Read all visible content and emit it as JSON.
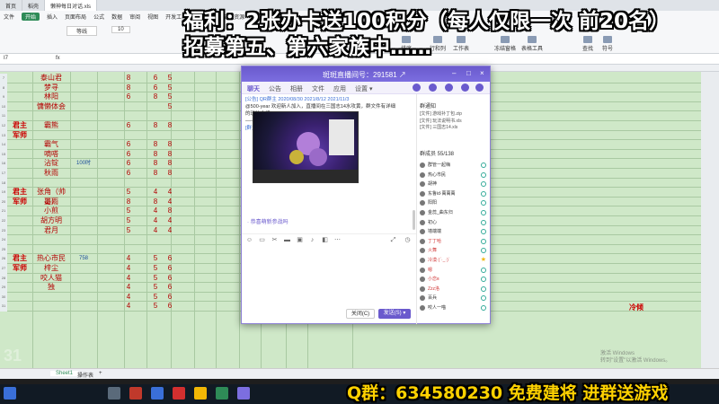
{
  "top_tabs": [
    "首页",
    "稻壳",
    "懒神每日对话.xls"
  ],
  "ribbon": {
    "menu": [
      "文件",
      "开始",
      "插入",
      "页面布局",
      "公式",
      "数据",
      "审阅",
      "视图",
      "开发工具",
      "会员专享",
      "稻壳资源"
    ],
    "font_name": "等线",
    "font_size": "10",
    "buttons": [
      "排序",
      "行和列",
      "工作表",
      "冻结窗格",
      "表格工具",
      "查找",
      "符号"
    ]
  },
  "formula_bar": {
    "cell_ref": "I7",
    "fx": "fx"
  },
  "rows": [
    {
      "n": "7",
      "role": "",
      "name": "泰山君",
      "note": "",
      "a": "8",
      "b": "6",
      "c": "5",
      "d": "",
      "e": "",
      "f": ""
    },
    {
      "n": "8",
      "role": "",
      "name": "梦寻",
      "note": "",
      "a": "8",
      "b": "6",
      "c": "5",
      "d": "",
      "e": "",
      "f": ""
    },
    {
      "n": "9",
      "role": "",
      "name": "林阳",
      "note": "",
      "a": "6",
      "b": "8",
      "c": "5",
      "d": "",
      "e": "",
      "f": ""
    },
    {
      "n": "10",
      "role": "",
      "name": "慵懒体会",
      "note": "",
      "a": "",
      "b": "",
      "c": "5",
      "d": "",
      "e": "",
      "f": ""
    },
    {
      "n": "11",
      "role": "",
      "name": "",
      "note": "",
      "a": "",
      "b": "",
      "c": "",
      "d": "",
      "e": "",
      "f": ""
    },
    {
      "n": "12",
      "role": "君主",
      "name": "霸熊",
      "note": "",
      "a": "6",
      "b": "8",
      "c": "8",
      "d": "",
      "e": "",
      "f": ""
    },
    {
      "n": "13",
      "role": "军师",
      "name": "",
      "note": "",
      "a": "",
      "b": "",
      "c": "",
      "d": "",
      "e": "",
      "f": ""
    },
    {
      "n": "14",
      "role": "",
      "name": "霸气",
      "note": "",
      "a": "6",
      "b": "8",
      "c": "8",
      "d": "",
      "e": "",
      "f": ""
    },
    {
      "n": "15",
      "role": "",
      "name": "嘀嗒",
      "note": "",
      "a": "6",
      "b": "8",
      "c": "8",
      "d": "",
      "e": "",
      "f": ""
    },
    {
      "n": "16",
      "role": "",
      "name": "沾锭",
      "note": "100时",
      "a": "6",
      "b": "8",
      "c": "8",
      "d": "",
      "e": "",
      "f": ""
    },
    {
      "n": "17",
      "role": "",
      "name": "秋雨",
      "note": "",
      "a": "6",
      "b": "8",
      "c": "8",
      "d": "",
      "e": "",
      "f": ""
    },
    {
      "n": "18",
      "role": "",
      "name": "",
      "note": "",
      "a": "",
      "b": "",
      "c": "",
      "d": "",
      "e": "",
      "f": ""
    },
    {
      "n": "19",
      "role": "君主",
      "name": "张角（帅哥）",
      "note": "",
      "a": "5",
      "b": "4",
      "c": "4",
      "d": "",
      "e": "",
      "f": ""
    },
    {
      "n": "20",
      "role": "军师",
      "name": "墨雨",
      "note": "",
      "a": "8",
      "b": "8",
      "c": "4",
      "d": "",
      "e": "",
      "f": ""
    },
    {
      "n": "21",
      "role": "",
      "name": "小煎",
      "note": "",
      "a": "5",
      "b": "4",
      "c": "8",
      "d": "",
      "e": "",
      "f": ""
    },
    {
      "n": "22",
      "role": "",
      "name": "胡方明",
      "note": "",
      "a": "5",
      "b": "4",
      "c": "4",
      "d": "",
      "e": "",
      "f": ""
    },
    {
      "n": "23",
      "role": "",
      "name": "君月",
      "note": "",
      "a": "5",
      "b": "4",
      "c": "4",
      "d": "",
      "e": "",
      "f": ""
    },
    {
      "n": "24",
      "role": "",
      "name": "",
      "note": "",
      "a": "",
      "b": "",
      "c": "",
      "d": "",
      "e": "",
      "f": ""
    },
    {
      "n": "25",
      "role": "",
      "name": "",
      "note": "",
      "a": "",
      "b": "",
      "c": "",
      "d": "",
      "e": "",
      "f": ""
    },
    {
      "n": "26",
      "role": "君主",
      "name": "热心市民",
      "note": "758",
      "a": "4",
      "b": "5",
      "c": "6",
      "d": "",
      "e": "",
      "f": ""
    },
    {
      "n": "27",
      "role": "军师",
      "name": "梓尘",
      "note": "",
      "a": "4",
      "b": "5",
      "c": "6",
      "d": "",
      "e": "",
      "f": ""
    },
    {
      "n": "28",
      "role": "",
      "name": "咬人猫",
      "note": "",
      "a": "4",
      "b": "5",
      "c": "6",
      "d": "15",
      "e": "8",
      "f": "咬人猫"
    },
    {
      "n": "29",
      "role": "",
      "name": "独",
      "note": "",
      "a": "4",
      "b": "5",
      "c": "6",
      "d": "15",
      "e": "38",
      "f": ""
    },
    {
      "n": "30",
      "role": "",
      "name": "",
      "note": "",
      "a": "4",
      "b": "5",
      "c": "6",
      "d": "15",
      "e": "4",
      "f": ""
    },
    {
      "n": "31",
      "role": "",
      "name": "",
      "note": "",
      "a": "4",
      "b": "5",
      "c": "6",
      "d": "15",
      "e": "108",
      "f": "大哥哥"
    }
  ],
  "side_value": "冷倾",
  "sheet_tabs": [
    "Sheet1",
    "操作表",
    "+"
  ],
  "banners": {
    "line1": "福利：2张办卡送100积分（每人仅限一次 前20名）",
    "line2": "招募第五、第六家族中……",
    "line3": "Q群：634580230 免费建将 进群送游戏"
  },
  "watermark": "31",
  "activation": "激活 Windows\n转到\"设置\"以激活 Windows。",
  "chat": {
    "title": "斑斑直播间号：291581 ↗",
    "nav_tabs": [
      "聊天",
      "公告",
      "相册",
      "文件",
      "应用",
      "设置 ▾"
    ],
    "messages": [
      "[公告] QR群主 2020/08/30 2021/8/12 2021/11/3",
      "@500-year 欢迎新人加入，直播间在三国志14水攻黄，群文件有详细",
      "的玩法介绍。",
      "——来来群管理员（645668149）的提醒",
      "[群主] 群主一群哥好友群主 22:26:29"
    ],
    "last_message": "· 恭喜萌新参战吗",
    "close_label": "关闭(C)",
    "send_label": "发送(S) ▾",
    "notice_title": "群通知",
    "files": [
      "[文件] 游戏补丁包.zip",
      "[文件] 玩法说明书.xls",
      "[文件] 三国志14.xls"
    ],
    "members_title": "群成员 55/138",
    "members": [
      {
        "name": "群管一起嗨",
        "red": false,
        "star": false
      },
      {
        "name": "热心市民",
        "red": false,
        "star": false
      },
      {
        "name": "胡神",
        "red": false,
        "star": false
      },
      {
        "name": "东鲁id·萬萬萬",
        "red": false,
        "star": false
      },
      {
        "name": "阳阳",
        "red": false,
        "star": false
      },
      {
        "name": "金蕊_曲东归",
        "red": false,
        "star": false
      },
      {
        "name": "初心",
        "red": false,
        "star": false
      },
      {
        "name": "墙端端",
        "red": false,
        "star": false
      },
      {
        "name": "丁丁哈",
        "red": true,
        "star": false
      },
      {
        "name": "火舞",
        "red": true,
        "star": false
      },
      {
        "name": "冷漠·(ˊ·_·)ˋ",
        "red": true,
        "star": true
      },
      {
        "name": "嗯",
        "red": true,
        "star": false
      },
      {
        "name": "小恋ɞ",
        "red": true,
        "star": false
      },
      {
        "name": "Zzz洛",
        "red": true,
        "star": false
      },
      {
        "name": "百兵",
        "red": false,
        "star": false
      },
      {
        "name": "咬人一喵",
        "red": false,
        "star": false
      }
    ]
  }
}
